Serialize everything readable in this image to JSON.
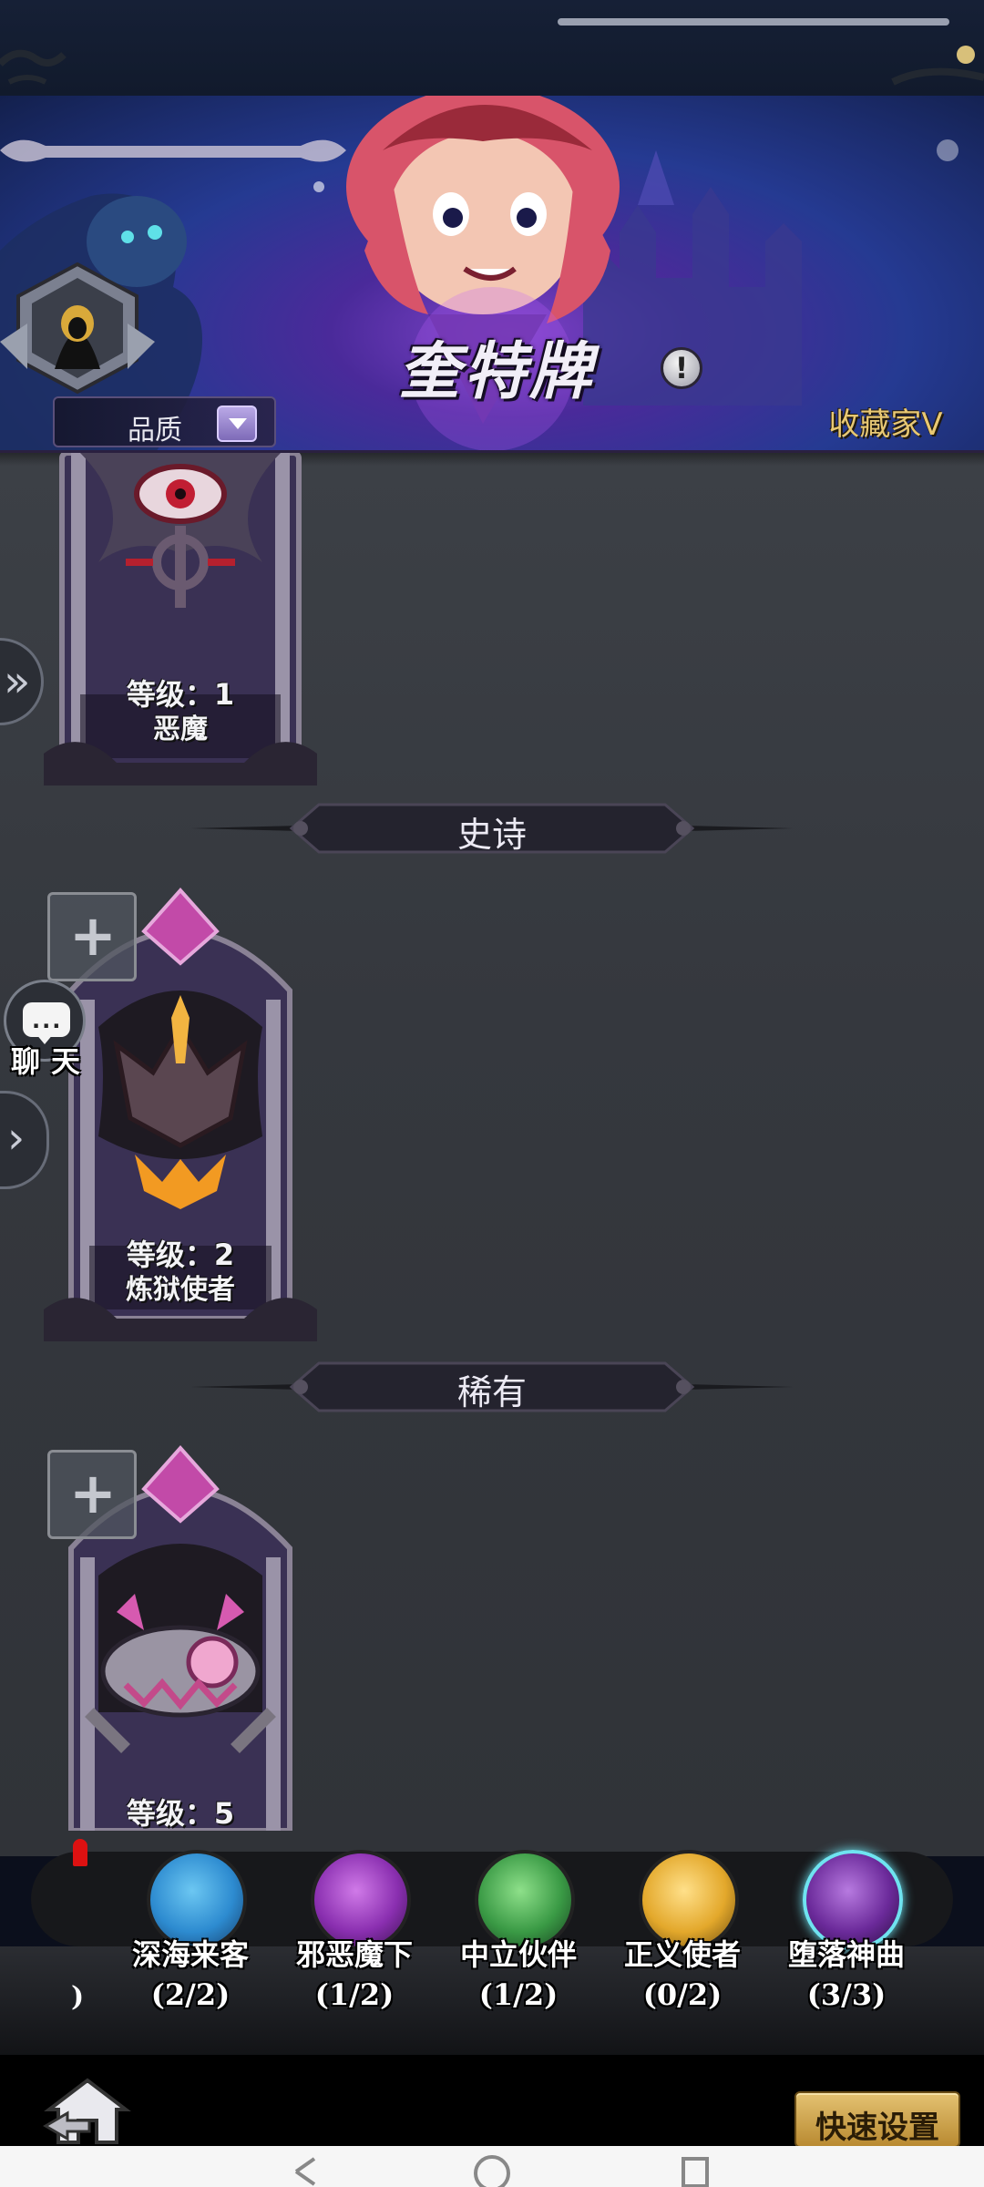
{
  "banner": {
    "title": "奎特牌",
    "info_symbol": "!",
    "quality_filter_label": "品质",
    "collector_label": "收藏家V"
  },
  "cards": [
    {
      "level": "等级：1",
      "name": "恶魔"
    },
    {
      "level": "等级：2",
      "name": "炼狱使者",
      "add_symbol": "+"
    },
    {
      "level": "等级：5",
      "name": "",
      "add_symbol": "+"
    }
  ],
  "sections": [
    {
      "label": "史诗"
    },
    {
      "label": "稀有"
    }
  ],
  "side": {
    "tab_top_symbol": "»",
    "tab_mid_symbol": "›",
    "chat_label": "聊天",
    "chat_dots": "..."
  },
  "factions": [
    {
      "name": "深海来客",
      "count": "(2/2)",
      "color": "#2d8bd0",
      "icon": "wave-icon"
    },
    {
      "name": "邪恶魔下",
      "count": "(1/2)",
      "color": "#8a2fb0",
      "icon": "horns-icon"
    },
    {
      "name": "中立伙伴",
      "count": "(1/2)",
      "color": "#3a9a45",
      "icon": "spiral-icon"
    },
    {
      "name": "正义使者",
      "count": "(0/2)",
      "color": "#e3a82b",
      "icon": "sun-icon"
    },
    {
      "name": "堕落神曲",
      "count": "(3/3)",
      "color": "#6b2a9a",
      "icon": "eye-icon"
    }
  ],
  "faction_partial_text": ")",
  "bottom": {
    "quick_setup_label": "快速设置"
  }
}
